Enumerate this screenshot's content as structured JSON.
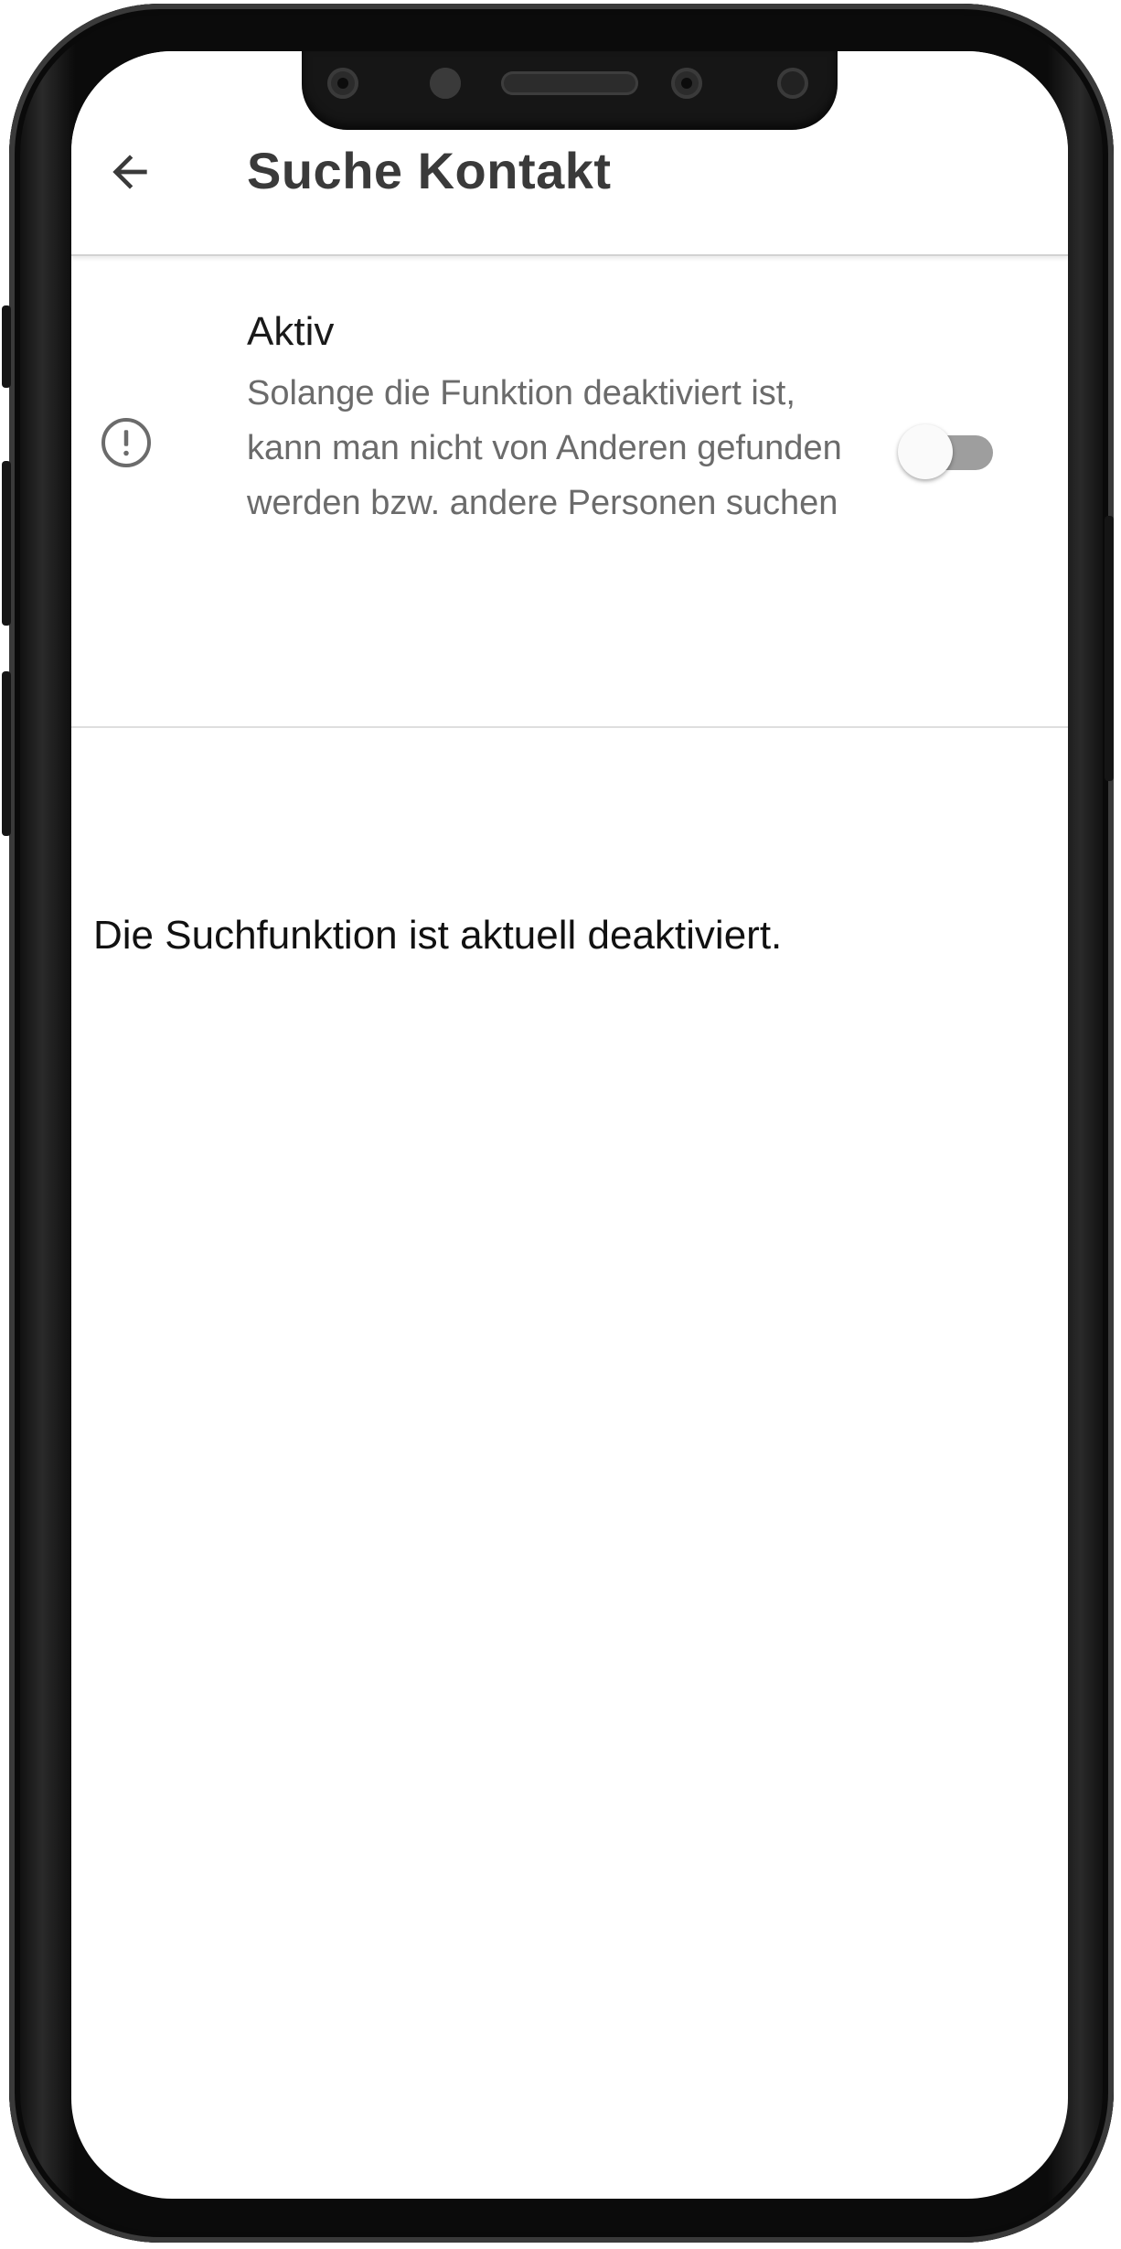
{
  "appbar": {
    "back_icon": "arrow-left-icon",
    "title": "Suche Kontakt"
  },
  "setting": {
    "icon": "alert-circle-icon",
    "label": "Aktiv",
    "description": "Solange die Funktion deaktiviert ist, kann man nicht von Anderen gefunden werden bzw. andere Personen suchen",
    "toggle_on": false
  },
  "status_message": "Die Suchfunktion ist aktuell deaktiviert.",
  "colors": {
    "title": "#3a3a3a",
    "description": "#6b6b6b",
    "toggle_track_off": "#9e9e9e",
    "toggle_thumb_off": "#fafafa",
    "divider": "#dedede"
  }
}
